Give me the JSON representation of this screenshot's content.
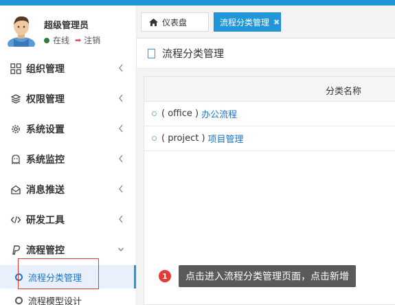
{
  "user": {
    "name": "超级管理员",
    "status": "在线",
    "logout": "注销"
  },
  "menu": [
    {
      "label": "组织管理",
      "icon": "grid-icon"
    },
    {
      "label": "权限管理",
      "icon": "layers-icon"
    },
    {
      "label": "系统设置",
      "icon": "gear-icon"
    },
    {
      "label": "系统监控",
      "icon": "ghost-icon"
    },
    {
      "label": "消息推送",
      "icon": "mail-icon"
    },
    {
      "label": "研发工具",
      "icon": "code-icon"
    },
    {
      "label": "流程管控",
      "icon": "paypal-icon",
      "expanded": true
    }
  ],
  "submenu": [
    {
      "label": "流程分类管理",
      "active": true
    },
    {
      "label": "流程模型设计",
      "active": false
    }
  ],
  "tabs": {
    "home": "仪表盘",
    "active": "流程分类管理"
  },
  "page": {
    "title": "流程分类管理"
  },
  "table": {
    "header": "分类名称",
    "rows": [
      {
        "code": "( office )",
        "name": "办公流程"
      },
      {
        "code": "( project )",
        "name": "项目管理"
      }
    ]
  },
  "tip": {
    "number": "1",
    "text": "点击进入流程分类管理页面，点击新增"
  },
  "colors": {
    "accent": "#2196d9",
    "highlight": "#e53935"
  }
}
